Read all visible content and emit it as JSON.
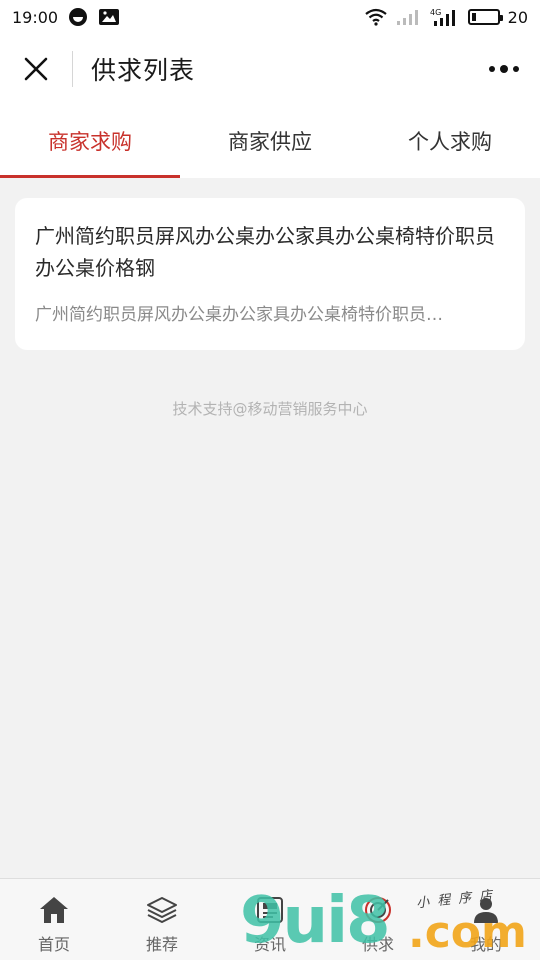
{
  "status_bar": {
    "time": "19:00",
    "battery": "20",
    "network": "4G",
    "battery_level": 0.2
  },
  "header": {
    "title": "供求列表"
  },
  "tabs": [
    {
      "label": "商家求购",
      "active": true
    },
    {
      "label": "商家供应",
      "active": false
    },
    {
      "label": "个人求购",
      "active": false
    }
  ],
  "list": [
    {
      "title": "广州简约职员屏风办公桌办公家具办公桌椅特价职员办公桌价格钢",
      "description": "广州简约职员屏风办公桌办公家具办公桌椅特价职员…"
    }
  ],
  "footer_note": "技术支持@移动营销服务中心",
  "bottom_nav": [
    {
      "label": "首页",
      "icon": "home-icon"
    },
    {
      "label": "推荐",
      "icon": "layers-icon"
    },
    {
      "label": "资讯",
      "icon": "news-icon"
    },
    {
      "label": "供求",
      "icon": "target-icon"
    },
    {
      "label": "我的",
      "icon": "user-icon"
    }
  ],
  "watermark": {
    "main": "9ui8",
    "suffix": ".com",
    "tagline": "小程序店"
  },
  "colors": {
    "accent": "#c8312b",
    "background": "#f2f2f2",
    "watermark_green": "#3fc2a7",
    "watermark_orange": "#f2a51a"
  }
}
